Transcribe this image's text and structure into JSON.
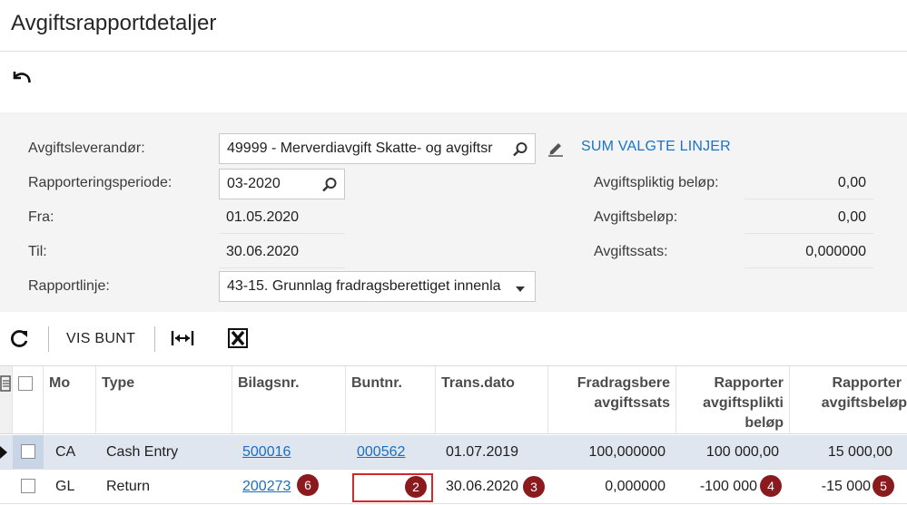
{
  "page": {
    "title": "Avgiftsrapportdetaljer"
  },
  "form": {
    "provider": {
      "label": "Avgiftsleverandør:",
      "value": "49999 - Merverdiavgift Skatte- og avgiftsr"
    },
    "period": {
      "label": "Rapporteringsperiode:",
      "value": "03-2020"
    },
    "from": {
      "label": "Fra:",
      "value": "01.05.2020"
    },
    "to": {
      "label": "Til:",
      "value": "30.06.2020"
    },
    "report_line": {
      "label": "Rapportlinje:",
      "value": "43-15. Grunnlag fradragsberettiget innenla"
    }
  },
  "summary": {
    "link_label": "SUM VALGTE LINJER",
    "taxable": {
      "label": "Avgiftspliktig beløp:",
      "value": "0,00"
    },
    "tax": {
      "label": "Avgiftsbeløp:",
      "value": "0,00"
    },
    "rate": {
      "label": "Avgiftssats:",
      "value": "0,000000"
    }
  },
  "toolbar": {
    "show_batch_label": "VIS BUNT"
  },
  "icons": {
    "undo": "undo-icon",
    "search": "search-icon",
    "edit": "pencil-icon",
    "dropdown": "chevron-down-icon",
    "refresh": "refresh-icon",
    "fit_columns": "fit-columns-icon",
    "excel": "excel-export-icon",
    "row_details": "row-details-icon",
    "current_row": "current-row-indicator-icon"
  },
  "grid": {
    "headers": {
      "mo": "Mo",
      "type": "Type",
      "doc_no": "Bilagsnr.",
      "batch_no": "Buntnr.",
      "trans_date": "Trans.dato",
      "deductible_rate_1": "Fradragsbere",
      "deductible_rate_2": "avgiftssats",
      "reported_taxable_1": "Rapporter",
      "reported_taxable_2": "avgiftsplikti",
      "reported_taxable_3": "beløp",
      "reported_tax_1": "Rapporter",
      "reported_tax_2": "avgiftsbeløp"
    },
    "rows": [
      {
        "mo": "CA",
        "type": "Cash Entry",
        "doc_no": "500016",
        "batch_no": "000562",
        "trans_date": "01.07.2019",
        "deductible_rate": "100,000000",
        "reported_taxable": "100 000,00",
        "reported_tax": "15 000,00"
      },
      {
        "mo": "GL",
        "type": "Return",
        "doc_no": "200273",
        "batch_no": "",
        "trans_date": "30.06.2020",
        "deductible_rate": "0,000000",
        "reported_taxable": "-100 000",
        "reported_tax": "-15 000"
      }
    ]
  },
  "badges": {
    "b6": "6",
    "b2": "2",
    "b3": "3",
    "b4": "4",
    "b5": "5"
  },
  "colors": {
    "link": "#1a6fc2",
    "badge": "#8b1a1f",
    "highlight_box": "#d22a2a",
    "selected_row": "#dfe6ef"
  }
}
